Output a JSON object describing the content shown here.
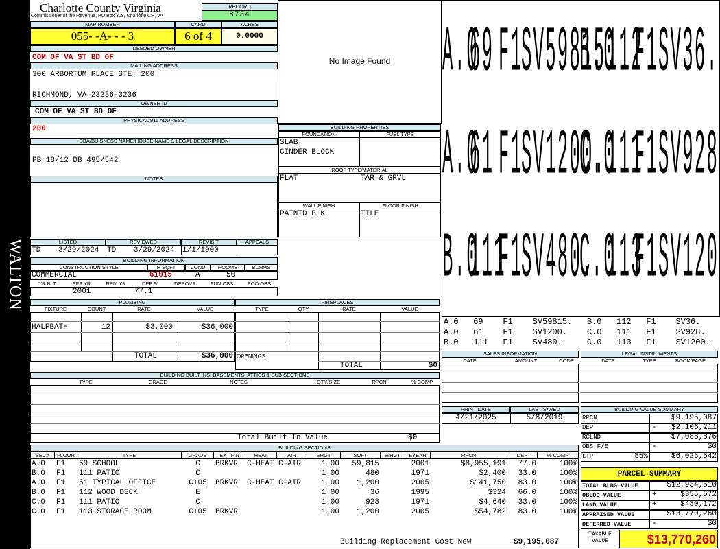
{
  "side_label": "WALTON",
  "header": {
    "county": "Charlotte County Virginia",
    "commissioner": "Commissioner of the Revenue, PO Box 308, Charlotte CH, VA",
    "record_label": "RECORD",
    "record": "8734",
    "map_label": "MAP NUMBER",
    "map_number": "055- -A- - - 3",
    "card_label": "CARD",
    "card": "6 of 4",
    "acres_label": "ACRES",
    "acres": "0.0000"
  },
  "owner": {
    "deeded_label": "DEEDED OWNER",
    "deeded": "COM OF VA ST BD OF",
    "mailing_label": "MAILING ADDRESS",
    "addr1": "300 ARBORTUM PLACE STE. 200",
    "addr2": "RICHMOND, VA 23236-3236",
    "owner_id_label": "OWNER ID",
    "owner_id": "COM OF VA ST BD OF",
    "physical_label": "PHYSICAL 911 ADDRESS",
    "physical": "200"
  },
  "dba": {
    "label": "DBA/BUISNESS NAME/HOUSE NAME & LEGAL DESCRIPTION",
    "text": "PB 18/12 DB 495/542"
  },
  "notes_label": "NOTES",
  "photo": {
    "text": "No Image Found"
  },
  "building_props": {
    "label": "BUILDING PROPERTIES",
    "foundation_label": "FOUNDATION",
    "fuel_label": "FUEL TYPE",
    "foundation1": "SLAB",
    "foundation2": "CINDER BLOCK",
    "roof_label": "ROOF TYPE/MATERIAL",
    "roof1": "FLAT",
    "roof2": "TAR & GRVL",
    "wall_label": "WALL FINISH",
    "floor_label": "FLOOR FINISH",
    "wall": "PAINTD BLK",
    "floor": "TILE"
  },
  "sketch": {
    "rows": [
      [
        "A.0",
        "69",
        "F1",
        "SV59815.",
        "B.0",
        "112",
        "F1",
        "SV36."
      ],
      [
        "A.0",
        "61",
        "F1",
        "SV1200.",
        "C.0",
        "111",
        "F1",
        "SV928."
      ],
      [
        "B.0",
        "111",
        "F1",
        "SV480.",
        "C.0",
        "113",
        "F1",
        "SV1200."
      ]
    ]
  },
  "sketch_legend": {
    "lines": [
      "A.0   69    F1    SV59815.   B.0   112   F1    SV36.",
      "A.0   61    F1    SV1200.    C.0   111   F1    SV928.",
      "B.0   111   F1    SV480.     C.0   113   F1    SV1200."
    ]
  },
  "listing": {
    "listed_label": "LISTED",
    "reviewed_label": "REVIEWED",
    "revisit_label": "REVISIT",
    "appeals_label": "APPEALS",
    "listed_code": "TD",
    "listed_date": "3/29/2024",
    "reviewed_code": "TD",
    "reviewed_date": "3/29/2024",
    "revisit": "1/1/1900"
  },
  "building_info": {
    "label": "BUILDING INFORMATION",
    "style_label": "CONSTRUCTION STYLE",
    "hsqft_label": "H SQFT",
    "cond_label": "COND",
    "rooms_label": "ROOMS",
    "bdrms_label": "BDRMS",
    "style": "COMMERCIAL",
    "hsqft": "61015",
    "cond": "A",
    "rooms": "50",
    "yrblt_label": "YR BLT",
    "effyr_label": "EFF YR",
    "remyr_label": "REM YR",
    "dep_label": "DEP %",
    "depovr_label": "DEPOVR",
    "funobs_label": "FUN OBS",
    "ecoobs_label": "ECO OBS",
    "effyr": "2001",
    "dep": "77.1"
  },
  "plumbing": {
    "label": "PLUMBING",
    "fixture_label": "FIXTURE",
    "count_label": "COUNT",
    "rate_label": "RATE",
    "value_label": "VALUE",
    "fixture": "HALFBATH",
    "count": "12",
    "rate": "$3,000",
    "value": "$36,000",
    "total_label": "TOTAL",
    "total": "$36,000"
  },
  "fireplaces": {
    "label": "FIREPLACES",
    "type_label": "TYPE",
    "qty_label": "QTY",
    "rate_label": "RATE",
    "value_label": "VALUE",
    "openings_label": "OPENINGS",
    "total_label": "TOTAL",
    "total": "$0"
  },
  "sales": {
    "label": "SALES INFORMATION",
    "date_label": "DATE",
    "amount_label": "AMOUNT",
    "code_label": "CODE"
  },
  "legal": {
    "label": "LEGAL INSTRUMENTS",
    "date_label": "DATE",
    "type_label": "TYPE",
    "book_label": "BOOK/PAGE"
  },
  "builtins": {
    "label": "BUILDING BUILT INS, BASEMENTS, ATTICS & SUB SECTIONS",
    "type_label": "TYPE",
    "grade_label": "GRADE",
    "notes_label": "NOTES",
    "qty_label": "QTY/SIZE",
    "rpcn_label": "RPCN",
    "comp_label": "% COMP",
    "total_label": "Total Built In Value",
    "total": "$0"
  },
  "dates": {
    "print_label": "PRINT DATE",
    "saved_label": "LAST SAVED",
    "print": "4/21/2025",
    "saved": "5/8/2019"
  },
  "bvs": {
    "label": "BUILDING VALUE SUMMARY",
    "rows": [
      {
        "label": "RPCN",
        "sign": "",
        "value": "$9,195,087"
      },
      {
        "label": "DEP",
        "sign": "-",
        "value": "$2,106,211"
      },
      {
        "label": "RCLND",
        "sign": "",
        "value": "$7,088,876"
      },
      {
        "label": "OBS F/E",
        "sign": "-",
        "value": "$0"
      },
      {
        "label": "LTP",
        "pct": "85%",
        "sign": "",
        "value": "$6,025,542"
      }
    ]
  },
  "parcel": {
    "label": "PARCEL SUMMARY",
    "rows": [
      {
        "label": "TOTAL BLDG VALUE",
        "sign": "",
        "value": "$12,934,510"
      },
      {
        "label": "OBLDG VALUE",
        "sign": "+",
        "value": "$355,572"
      },
      {
        "label": "LAND VALUE",
        "sign": "+",
        "value": "$480,172"
      },
      {
        "label": "APPRAISED VALUE",
        "sign": "",
        "value": "$13,770,260"
      },
      {
        "label": "DEFERRED VALUE",
        "sign": "-",
        "value": "$0"
      }
    ],
    "taxable_label": "TAXABLE VALUE",
    "taxable": "$13,770,260"
  },
  "sections": {
    "label": "BUILDING SECTIONS",
    "cols": [
      "SEC#",
      "FLOOR",
      "TYPE",
      "GRADE",
      "EXT FIN",
      "HEAT",
      "AIR",
      "SHGT",
      "SQFT",
      "WHGT",
      "EYEAR",
      "RPCN",
      "DEP",
      "% COMP"
    ],
    "rows": [
      [
        "A.0",
        "F1",
        "69 SCHOOL",
        "C",
        "BRKVR",
        "C-HEAT",
        "C-AIR",
        "1.00",
        "59,815",
        "",
        "2001",
        "$8,955,191",
        "77.0",
        "100%"
      ],
      [
        "B.0",
        "F1",
        "111 PATIO",
        "C",
        "",
        "",
        "",
        "1.00",
        "480",
        "",
        "1971",
        "$2,400",
        "33.0",
        "100%"
      ],
      [
        "A.0",
        "F1",
        "61 TYPICAL OFFICE",
        "C+05",
        "BRKVR",
        "C-HEAT",
        "C-AIR",
        "1.00",
        "1,200",
        "",
        "2005",
        "$141,750",
        "83.0",
        "100%"
      ],
      [
        "B.0",
        "F1",
        "112 WOOD DECK",
        "E",
        "",
        "",
        "",
        "1.00",
        "36",
        "",
        "1995",
        "$324",
        "66.0",
        "100%"
      ],
      [
        "C.0",
        "F1",
        "111 PATIO",
        "C",
        "",
        "",
        "",
        "1.00",
        "928",
        "",
        "1971",
        "$4,640",
        "33.0",
        "100%"
      ],
      [
        "C.0",
        "F1",
        "113 STORAGE ROOM",
        "C+05",
        "BRKVR",
        "",
        "",
        "1.00",
        "1,200",
        "",
        "2005",
        "$54,782",
        "83.0",
        "100%"
      ]
    ],
    "total_label": "Building Replacement Cost New",
    "total": "$9,195,087"
  }
}
